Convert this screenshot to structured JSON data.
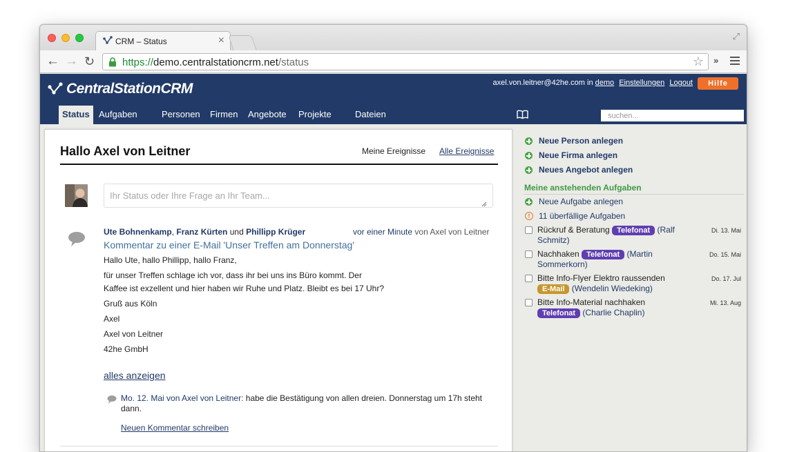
{
  "browser": {
    "tab_title": "CRM – Status",
    "tab_close": "×",
    "url_protocol": "https://",
    "url_host": "demo.centralstationcrm.net",
    "url_path": "/status",
    "back": "←",
    "forward": "→",
    "reload": "↻",
    "star": "☆",
    "extensions": "»",
    "fullscreen": "⤢"
  },
  "header": {
    "logo": "CentralStationCRM",
    "user_email": "axel.von.leitner@42he.com",
    "in_text": "in",
    "account": "demo",
    "settings": "Einstellungen",
    "logout": "Logout",
    "help": "Hilfe"
  },
  "nav": {
    "items": [
      "Status",
      "Aufgaben",
      "Personen",
      "Firmen",
      "Angebote",
      "Projekte",
      "Dateien"
    ],
    "search_placeholder": "suchen..."
  },
  "main": {
    "greeting": "Hallo Axel von Leitner",
    "filter_mine": "Meine Ereignisse",
    "filter_all": "Alle Ereignisse",
    "status_placeholder": "Ihr Status oder Ihre Frage an Ihr Team...",
    "post": {
      "person1": "Ute Bohnenkamp",
      "sep1": ",",
      "person2": "Franz Kürten",
      "and": "und",
      "person3": "Phillipp Krüger",
      "time": "vor einer Minute",
      "by": "von Axel von Leitner",
      "title": "Kommentar zu einer E-Mail 'Unser Treffen am Donnerstag'",
      "body": [
        "Hallo Ute, hallo Phillipp, hallo Franz,",
        "für unser Treffen schlage ich vor, dass ihr bei uns ins Büro kommt. Der Kaffee ist exzellent und hier haben wir Ruhe und Platz. Bleibt es bei 17 Uhr?",
        "Gruß aus Köln",
        "Axel",
        "Axel von Leitner",
        "42he GmbH"
      ],
      "show_all": "alles anzeigen"
    },
    "reply": {
      "date_author": "Mo. 12. Mai von Axel von Leitner:",
      "text": "habe die Bestätigung von allen dreien. Donnerstag um 17h steht dann."
    },
    "new_comment": "Neuen Kommentar schreiben"
  },
  "sidebar": {
    "actions": [
      "Neue Person anlegen",
      "Neue Firma anlegen",
      "Neues Angebot anlegen"
    ],
    "tasks_heading": "Meine anstehenden Aufgaben",
    "new_task": "Neue Aufgabe anlegen",
    "overdue": "11 überfällige Aufgaben",
    "tasks": [
      {
        "title": "Rückruf & Beratung",
        "badge": "Telefonat",
        "contact": "(Ralf Schmitz)",
        "due": "Di. 13. Mai"
      },
      {
        "title": "Nachhaken",
        "badge": "Telefonat",
        "contact": "(Martin Sommerkorn)",
        "due": "Do. 15. Mai"
      },
      {
        "title": "Bitte Info-Flyer Elektro raussenden",
        "badge": "E-Mail",
        "contact": "(Wendelin Wiedeking)",
        "due": "Do. 17. Jul"
      },
      {
        "title": "Bitte Info-Material nachhaken",
        "badge": "Telefonat",
        "contact": "(Charlie Chaplin)",
        "due": "Mi. 13. Aug"
      }
    ]
  },
  "colors": {
    "header_bg": "#213a68",
    "help_orange": "#f0702a",
    "badge_telefonat": "#5f3eb0",
    "badge_email": "#c8962e",
    "tasks_green": "#3f9a45"
  }
}
